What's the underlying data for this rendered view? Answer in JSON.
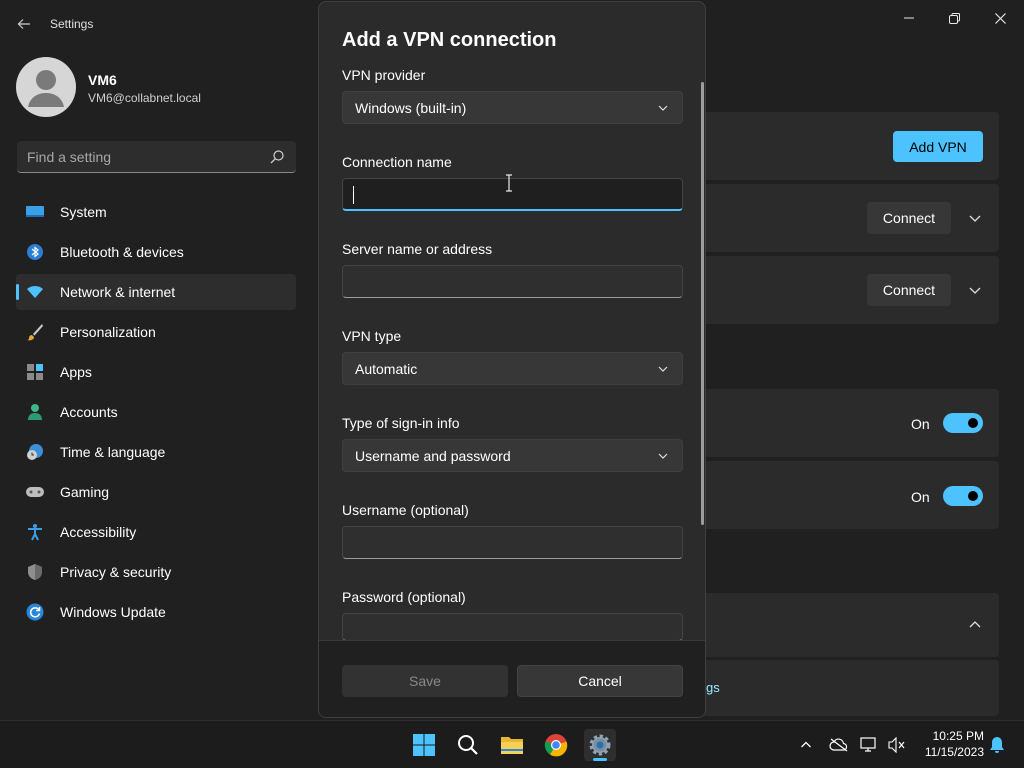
{
  "app": {
    "title": "Settings"
  },
  "profile": {
    "name": "VM6",
    "email": "VM6@collabnet.local"
  },
  "search": {
    "placeholder": "Find a setting"
  },
  "sidebar": {
    "items": [
      {
        "label": "System",
        "icon": "system-icon",
        "active": false
      },
      {
        "label": "Bluetooth & devices",
        "icon": "bluetooth-icon",
        "active": false
      },
      {
        "label": "Network & internet",
        "icon": "wifi-icon",
        "active": true
      },
      {
        "label": "Personalization",
        "icon": "brush-icon",
        "active": false
      },
      {
        "label": "Apps",
        "icon": "apps-icon",
        "active": false
      },
      {
        "label": "Accounts",
        "icon": "person-icon",
        "active": false
      },
      {
        "label": "Time & language",
        "icon": "clock-globe-icon",
        "active": false
      },
      {
        "label": "Gaming",
        "icon": "gamepad-icon",
        "active": false
      },
      {
        "label": "Accessibility",
        "icon": "accessibility-icon",
        "active": false
      },
      {
        "label": "Privacy & security",
        "icon": "shield-icon",
        "active": false
      },
      {
        "label": "Windows Update",
        "icon": "update-icon",
        "active": false
      }
    ]
  },
  "background": {
    "add_vpn_label": "Add VPN",
    "connect_label_1": "Connect",
    "connect_label_2": "Connect",
    "toggle_1": "On",
    "toggle_2": "On",
    "link_fragment": "gs"
  },
  "dialog": {
    "title": "Add a VPN connection",
    "vpn_provider": {
      "label": "VPN provider",
      "value": "Windows (built-in)"
    },
    "connection_name": {
      "label": "Connection name",
      "value": ""
    },
    "server": {
      "label": "Server name or address",
      "value": ""
    },
    "vpn_type": {
      "label": "VPN type",
      "value": "Automatic"
    },
    "sign_in_type": {
      "label": "Type of sign-in info",
      "value": "Username and password"
    },
    "username": {
      "label": "Username (optional)",
      "value": ""
    },
    "password": {
      "label": "Password (optional)"
    },
    "save_label": "Save",
    "cancel_label": "Cancel"
  },
  "taskbar": {
    "apps": [
      "start-icon",
      "search-icon",
      "file-explorer-icon",
      "chrome-icon",
      "settings-icon"
    ],
    "time": "10:25 PM",
    "date": "11/15/2023"
  },
  "colors": {
    "accent": "#4cc2ff",
    "background": "#202020",
    "card": "#2b2b2b"
  }
}
